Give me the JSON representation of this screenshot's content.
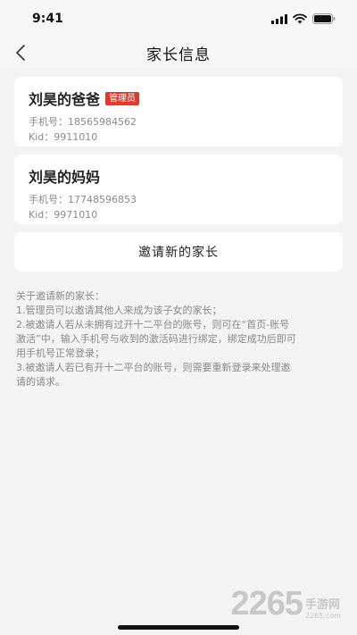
{
  "status_bar": {
    "time": "9:41"
  },
  "nav": {
    "title": "家长信息"
  },
  "parents": [
    {
      "name": "刘昊的爸爸",
      "badge": "管理员",
      "phone": "手机号：18565984562",
      "kid": "Kid：9911010"
    },
    {
      "name": "刘昊的妈妈",
      "badge": "",
      "phone": "手机号：17748596853",
      "kid": "Kid：9971010"
    }
  ],
  "invite": {
    "label": "邀请新的家长"
  },
  "notes": [
    "关于邀请新的家长：",
    "1.管理员可以邀请其他人来成为该子女的家长；",
    "2.被邀请人若从未拥有过开十二平台的账号，则可在“首页-账号",
    "激活”中，输入手机号与收到的激活码进行绑定，绑定成功后即可",
    "用手机号正常登录；",
    "3.被邀请人若已有开十二平台的账号，则需要重新登录来处理邀",
    "请的请求。"
  ],
  "watermark": {
    "number": "2265",
    "cn": "手游网",
    "url": "2265.com"
  },
  "colors": {
    "badge_red": "#e8362c",
    "background": "#f3f3f3",
    "card": "#ffffff"
  }
}
